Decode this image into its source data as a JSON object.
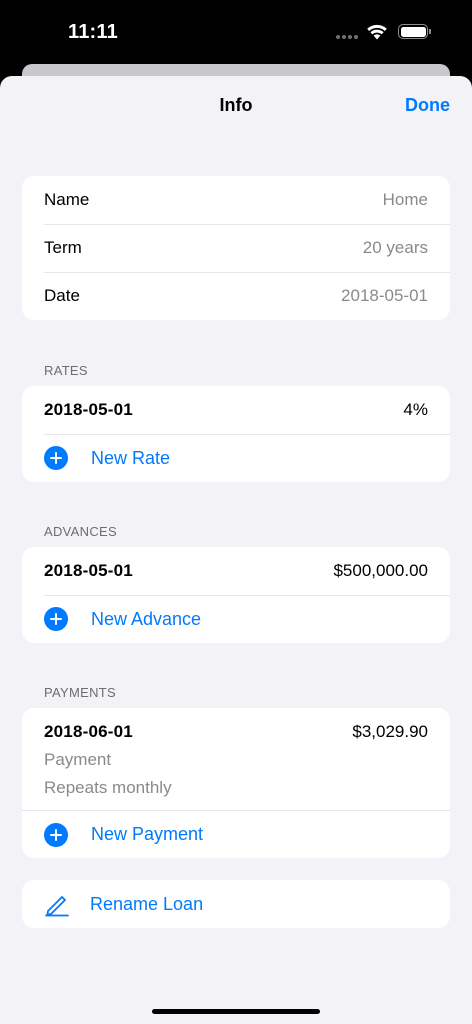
{
  "status_bar": {
    "time": "11:11"
  },
  "nav": {
    "title": "Info",
    "done_label": "Done"
  },
  "details": {
    "rows": [
      {
        "label": "Name",
        "value": "Home"
      },
      {
        "label": "Term",
        "value": "20 years"
      },
      {
        "label": "Date",
        "value": "2018-05-01"
      }
    ]
  },
  "rates": {
    "header": "RATES",
    "items": [
      {
        "date": "2018-05-01",
        "value": "4%"
      }
    ],
    "add_label": "New Rate"
  },
  "advances": {
    "header": "ADVANCES",
    "items": [
      {
        "date": "2018-05-01",
        "value": "$500,000.00"
      }
    ],
    "add_label": "New Advance"
  },
  "payments": {
    "header": "PAYMENTS",
    "items": [
      {
        "date": "2018-06-01",
        "value": "$3,029.90",
        "type": "Payment",
        "schedule": "Repeats monthly"
      }
    ],
    "add_label": "New Payment"
  },
  "rename": {
    "label": "Rename Loan"
  },
  "colors": {
    "accent": "#007aff",
    "background": "#f2f2f7",
    "secondary_text": "#8a8a8e"
  }
}
